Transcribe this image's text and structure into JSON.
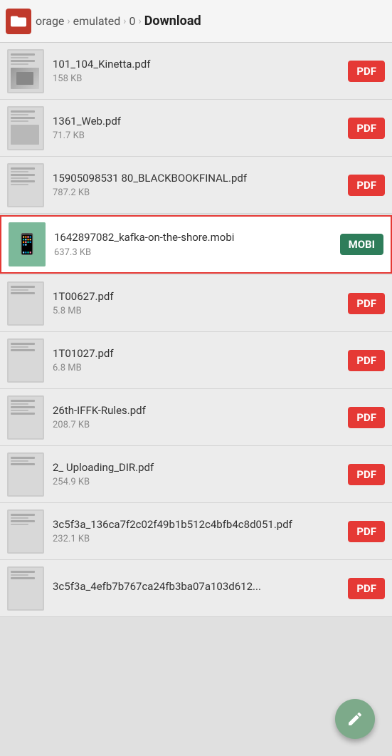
{
  "header": {
    "icon_label": "file-manager-icon",
    "breadcrumb": [
      "orage",
      "emulated",
      "0",
      "Download"
    ],
    "separators": [
      "›",
      "›",
      "›"
    ]
  },
  "files": [
    {
      "name": "101_104_Kinetta.pdf",
      "size": "158 KB",
      "type": "PDF",
      "selected": false
    },
    {
      "name": "1361_Web.pdf",
      "size": "71.7 KB",
      "type": "PDF",
      "selected": false
    },
    {
      "name": "15905098531 80_BLACKBOOKFINAL.pdf",
      "size": "787.2 KB",
      "type": "PDF",
      "selected": false
    },
    {
      "name": "1642897082_kafka-on-the-shore.mobi",
      "size": "637.3 KB",
      "type": "MOBI",
      "selected": true
    },
    {
      "name": "1T00627.pdf",
      "size": "5.8 MB",
      "type": "PDF",
      "selected": false
    },
    {
      "name": "1T01027.pdf",
      "size": "6.8 MB",
      "type": "PDF",
      "selected": false
    },
    {
      "name": "26th-IFFK-Rules.pdf",
      "size": "208.7 KB",
      "type": "PDF",
      "selected": false
    },
    {
      "name": "2_ Uploading_DIR.pdf",
      "size": "254.9 KB",
      "type": "PDF",
      "selected": false
    },
    {
      "name": "3c5f3a_136ca7f2c02f49b1b512c4bfb4c8d051.pdf",
      "size": "232.1 KB",
      "type": "PDF",
      "selected": false
    },
    {
      "name": "3c5f3a_4efb7b767ca24fb3ba07a103d612...",
      "size": "",
      "type": "PDF",
      "selected": false,
      "partial": true
    }
  ],
  "fab": {
    "label": "edit",
    "icon": "✎"
  },
  "colors": {
    "pdf_badge": "#e53935",
    "mobi_badge": "#2e7d5a",
    "selected_border": "#e53935",
    "selected_bg": "#ffffff",
    "fab_bg": "#7daa8a",
    "header_icon_bg": "#c0392b"
  }
}
